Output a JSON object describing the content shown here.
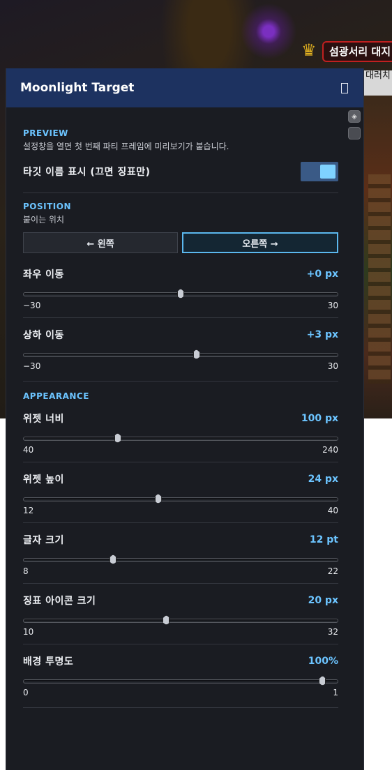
{
  "game": {
    "nameplate_text": "섬광서리 대지",
    "side_text": "대러치 ",
    "colors": {
      "accent_red": "#c02020",
      "portal_purple": "#7a2fc0"
    }
  },
  "panel": {
    "title": "Moonlight Target",
    "close_icon": "close-icon"
  },
  "preview": {
    "section_label": "PREVIEW",
    "description": "설정창을 열면 첫 번째 파티 프레임에 미리보기가 붙습니다.",
    "toggle_label": "타깃 이름 표시 (끄면 징표만)",
    "toggle_on": true
  },
  "position": {
    "section_label": "POSITION",
    "description": "붙이는 위치",
    "left_button": "← 왼쪽",
    "right_button": "오른쪽 →",
    "selected": "right",
    "sliders": [
      {
        "label": "좌우 이동",
        "value_text": "+0 px",
        "min": -30,
        "max": 30,
        "value": 0,
        "min_text": "−30",
        "max_text": "30"
      },
      {
        "label": "상하 이동",
        "value_text": "+3 px",
        "min": -30,
        "max": 30,
        "value": 3,
        "min_text": "−30",
        "max_text": "30"
      }
    ]
  },
  "appearance": {
    "section_label": "APPEARANCE",
    "sliders": [
      {
        "label": "위젯 너비",
        "value_text": "100 px",
        "min": 40,
        "max": 240,
        "value": 100,
        "min_text": "40",
        "max_text": "240"
      },
      {
        "label": "위젯 높이",
        "value_text": "24 px",
        "min": 12,
        "max": 40,
        "value": 24,
        "min_text": "12",
        "max_text": "40"
      },
      {
        "label": "글자 크기",
        "value_text": "12 pt",
        "min": 8,
        "max": 22,
        "value": 12,
        "min_text": "8",
        "max_text": "22"
      },
      {
        "label": "징표 아이콘 크기",
        "value_text": "20 px",
        "min": 10,
        "max": 32,
        "value": 20,
        "min_text": "10",
        "max_text": "32"
      },
      {
        "label": "배경 투명도",
        "value_text": "100%",
        "min": 0,
        "max": 1,
        "value": 0.95,
        "min_text": "0",
        "max_text": "1"
      }
    ]
  },
  "colors": {
    "title_bar": "#1d3260",
    "panel_bg": "#1a1c22",
    "accent_blue": "#6cc4ff",
    "toggle_on": "#3a5a86"
  }
}
